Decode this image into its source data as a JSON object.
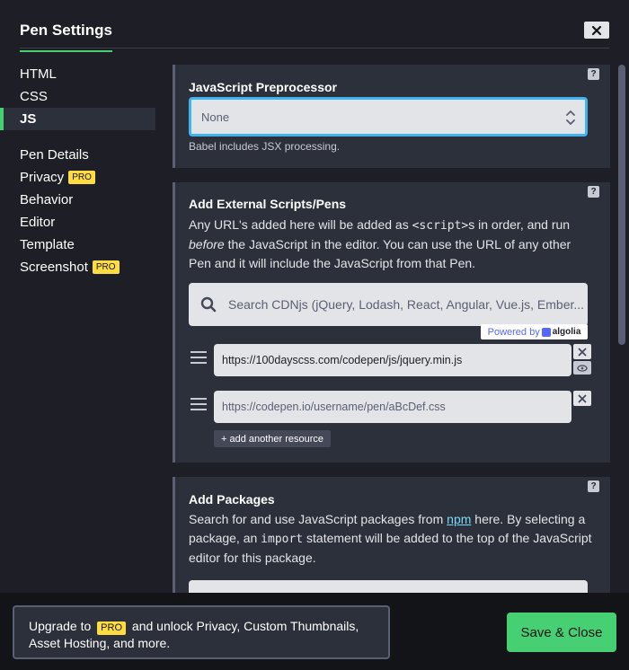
{
  "header": {
    "title": "Pen Settings",
    "close_icon": "close-icon"
  },
  "sidebar": {
    "group1": [
      {
        "label": "HTML",
        "active": false
      },
      {
        "label": "CSS",
        "active": false
      },
      {
        "label": "JS",
        "active": true
      }
    ],
    "group2": [
      {
        "label": "Pen Details",
        "pro": ""
      },
      {
        "label": "Privacy",
        "pro": "PRO"
      },
      {
        "label": "Behavior",
        "pro": ""
      },
      {
        "label": "Editor",
        "pro": ""
      },
      {
        "label": "Template",
        "pro": ""
      },
      {
        "label": "Screenshot",
        "pro": "PRO"
      }
    ]
  },
  "preprocessor": {
    "title": "JavaScript Preprocessor",
    "selected": "None",
    "hint": "Babel includes JSX processing.",
    "help": "?"
  },
  "external": {
    "title": "Add External Scripts/Pens",
    "help": "?",
    "desc_1": "Any URL's added here will be added as ",
    "desc_code": "<script>",
    "desc_2": "s in order, and run ",
    "desc_em": "before",
    "desc_3": " the JavaScript in the editor. You can use the URL of any other Pen and it will include the JavaScript from that Pen.",
    "search_placeholder": "Search CDNjs (jQuery, Lodash, React, Angular, Vue.js, Ember...",
    "powered_by": "Powered by",
    "algolia": "algolia",
    "resources": [
      {
        "value": "https://100dayscss.com/codepen/js/jquery.min.js",
        "placeholder": false
      },
      {
        "value": "https://codepen.io/username/pen/aBcDef.css",
        "placeholder": true
      }
    ],
    "add_label": "+ add another resource"
  },
  "packages": {
    "title": "Add Packages",
    "help": "?",
    "desc_1": "Search for and use JavaScript packages from ",
    "desc_link": "npm",
    "desc_2": " here. By selecting a package, an ",
    "desc_code": "import",
    "desc_3": " statement will be added to the top of the JavaScript editor for this package."
  },
  "footer": {
    "upgrade_1": "Upgrade to ",
    "upgrade_pro": "PRO",
    "upgrade_2": " and unlock Privacy, Custom Thumbnails, Asset Hosting, and more.",
    "save_label": "Save & Close"
  },
  "colors": {
    "accent_green": "#47cf73",
    "pro_yellow": "#ffdd40",
    "focus_blue": "#3fb4f0",
    "link_blue": "#76daff"
  }
}
